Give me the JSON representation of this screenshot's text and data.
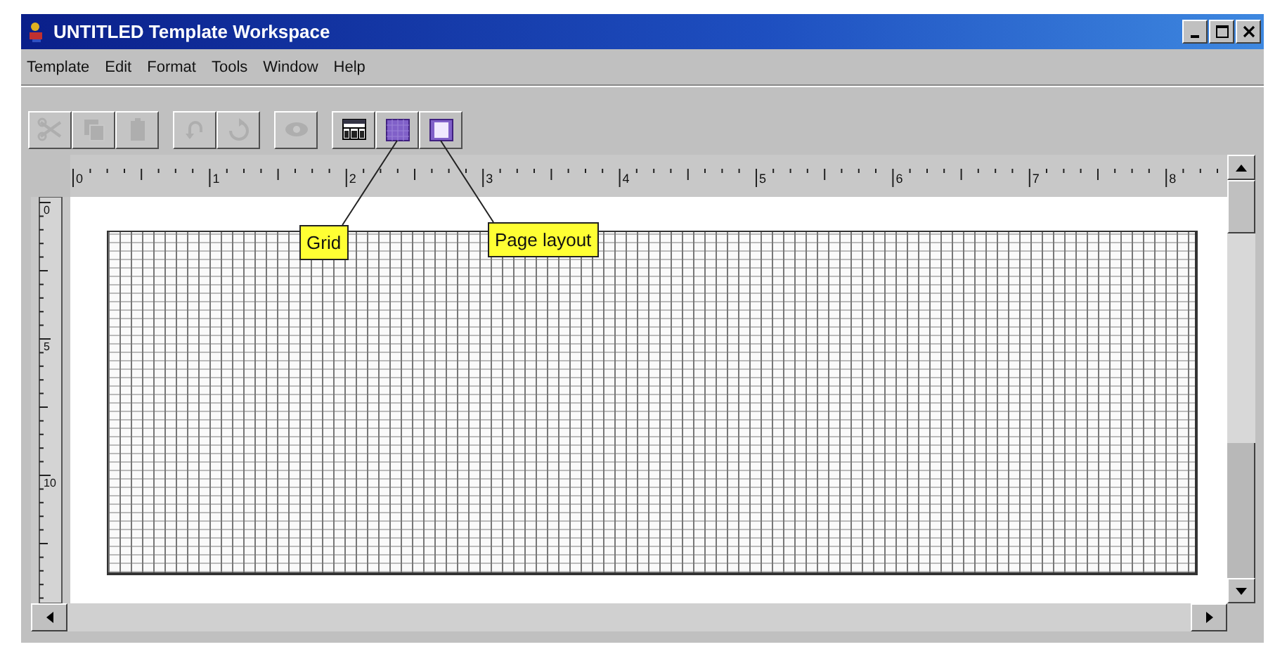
{
  "window": {
    "title": "UNTITLED Template Workspace"
  },
  "menu": [
    {
      "label": "Template"
    },
    {
      "label": "Edit"
    },
    {
      "label": "Format"
    },
    {
      "label": "Tools"
    },
    {
      "label": "Window"
    },
    {
      "label": "Help"
    }
  ],
  "toolbar": [
    {
      "kind": "cut",
      "disabled": true
    },
    {
      "kind": "copy",
      "disabled": true
    },
    {
      "kind": "paste",
      "disabled": true
    },
    {
      "kind": "undo",
      "disabled": true
    },
    {
      "kind": "redo",
      "disabled": true
    },
    {
      "kind": "preview",
      "disabled": true
    },
    {
      "kind": "table",
      "disabled": false
    },
    {
      "kind": "grid",
      "disabled": false,
      "callout": "Grid"
    },
    {
      "kind": "page",
      "disabled": false,
      "callout": "Page layout"
    }
  ],
  "ruler_h": [
    "0",
    "1",
    "2",
    "3",
    "4",
    "5",
    "6",
    "7",
    "8"
  ],
  "ruler_v": [
    "0",
    "5",
    "10"
  ]
}
